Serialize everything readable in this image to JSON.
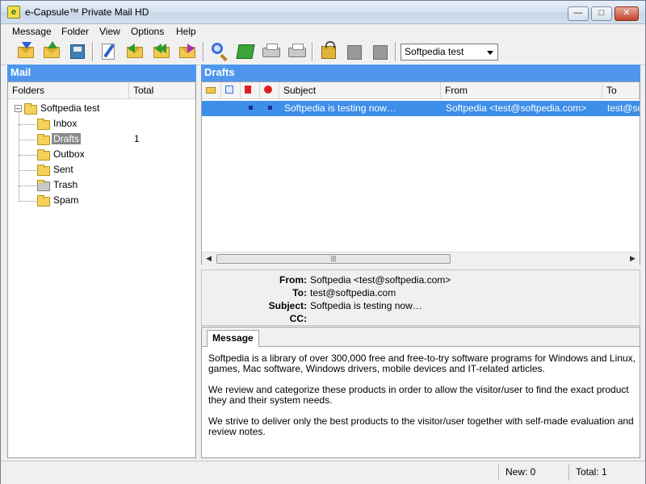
{
  "window": {
    "title": "e-Capsule™ Private Mail HD"
  },
  "menu": [
    "Message",
    "Folder",
    "View",
    "Options",
    "Help"
  ],
  "toolbar": {
    "profile": "Softpedia test"
  },
  "mail_pane": {
    "title": "Mail",
    "columns": {
      "folders": "Folders",
      "total": "Total"
    },
    "root": "Softpedia test",
    "folders": [
      {
        "name": "Inbox",
        "total": ""
      },
      {
        "name": "Drafts",
        "total": "1"
      },
      {
        "name": "Outbox",
        "total": ""
      },
      {
        "name": "Sent",
        "total": ""
      },
      {
        "name": "Trash",
        "total": ""
      },
      {
        "name": "Spam",
        "total": ""
      }
    ]
  },
  "list_pane": {
    "title": "Drafts",
    "columns": {
      "subject": "Subject",
      "from": "From",
      "to": "To"
    },
    "rows": [
      {
        "subject": "Softpedia is testing now…",
        "from": "Softpedia <test@softpedia.com>",
        "to": "test@softpedia.com"
      }
    ]
  },
  "preview": {
    "labels": {
      "from": "From:",
      "to": "To:",
      "subject": "Subject:",
      "cc": "CC:"
    },
    "from": "Softpedia <test@softpedia.com>",
    "to": "test@softpedia.com",
    "subject": "Softpedia is testing now…",
    "cc": "",
    "tab": "Message",
    "body": [
      "Softpedia is a library of over 300,000 free and free-to-try software programs for Windows and Linux, games, Mac software, Windows drivers, mobile devices and IT-related articles.",
      "We review and categorize these products in order to allow the visitor/user to find the exact product they and their system needs.",
      "We strive to deliver only the best products to the visitor/user together with self-made evaluation and review notes."
    ]
  },
  "status": {
    "new": "New: 0",
    "total": "Total: 1"
  }
}
